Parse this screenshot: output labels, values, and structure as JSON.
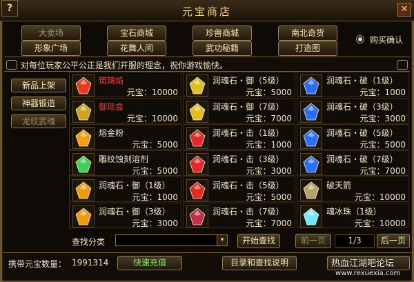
{
  "window": {
    "title": "元宝商店",
    "help_label": "?",
    "close_label": "✕"
  },
  "nav": {
    "row1": [
      "大卖场",
      "宝石商城",
      "珍兽商城",
      "南北奇货"
    ],
    "row2": [
      "形象广场",
      "花舞人间",
      "武功秘籍",
      "打造图"
    ]
  },
  "purchase_confirm": {
    "label": "购买确认",
    "checked": true
  },
  "notice": "对每位玩家公平公正是我们开服的理念，祝你游戏愉快。",
  "sidebar": [
    "新品上架",
    "神器锻造",
    "龙纹武魂"
  ],
  "items": [
    {
      "name": "琉璃焰",
      "price": "元宝：10000",
      "red": true,
      "icon": "flame-fan-icon",
      "color": "#e83a1a"
    },
    {
      "name": "润魂石・御（5级）",
      "price": "元宝：5000",
      "red": false,
      "icon": "yellow-gem-icon",
      "color": "#e0c020"
    },
    {
      "name": "润魂石・破（1级）",
      "price": "元宝：1000",
      "red": false,
      "icon": "blue-gem-icon",
      "color": "#2b6dff"
    },
    {
      "name": "御瑶盒",
      "price": "元宝：10000",
      "red": true,
      "icon": "gold-box-icon",
      "color": "#d0a020"
    },
    {
      "name": "润魂石・御（7级）",
      "price": "元宝：7000",
      "red": false,
      "icon": "yellow-gem-icon",
      "color": "#e0c020"
    },
    {
      "name": "润魂石・破（3级）",
      "price": "元宝：3000",
      "red": false,
      "icon": "blue-gem-icon",
      "color": "#2b6dff"
    },
    {
      "name": "熔金粉",
      "price": "元宝：5000",
      "red": false,
      "icon": "gold-powder-icon",
      "color": "#f0a010"
    },
    {
      "name": "润魂石・击（1级）",
      "price": "元宝：1000",
      "red": false,
      "icon": "red-gem-icon",
      "color": "#e32a2a"
    },
    {
      "name": "润魂石・破（5级）",
      "price": "元宝：5000",
      "red": false,
      "icon": "blue-gem-icon",
      "color": "#2b6dff"
    },
    {
      "name": "雕纹蚀刻溶剂",
      "price": "元宝：5000",
      "red": false,
      "icon": "green-solvent-icon",
      "color": "#3fd05a"
    },
    {
      "name": "润魂石・击（3级）",
      "price": "元宝：3000",
      "red": false,
      "icon": "red-gem-icon",
      "color": "#e32a2a"
    },
    {
      "name": "润魂石・破（7级）",
      "price": "元宝：7000",
      "red": false,
      "icon": "blue-gem-icon",
      "color": "#2b6dff"
    },
    {
      "name": "润魂石・御（1级）",
      "price": "元宝：1000",
      "red": false,
      "icon": "orange-gem-icon",
      "color": "#f09a10"
    },
    {
      "name": "润魂石・击（5级）",
      "price": "元宝：5000",
      "red": false,
      "icon": "red-gem-icon",
      "color": "#e32a2a"
    },
    {
      "name": "破天箭",
      "price": "元宝：10000",
      "red": false,
      "icon": "arrow-icon",
      "color": "#b8a070"
    },
    {
      "name": "润魂石・御（3级）",
      "price": "元宝：3000",
      "red": false,
      "icon": "orange-gem-icon",
      "color": "#f09a10"
    },
    {
      "name": "润魂石・击（7级）",
      "price": "元宝：7000",
      "red": false,
      "icon": "red-blue-gem-icon",
      "color": "#c0304a"
    },
    {
      "name": "魂冰珠（1级）",
      "price": "元宝：10000",
      "red": false,
      "icon": "ice-orb-icon",
      "color": "#6fe8ff"
    }
  ],
  "search": {
    "label": "查找分类",
    "dropdown_label": "▾",
    "start_label": "开始查找"
  },
  "paging": {
    "prev_label": "前一页",
    "page": "1/3",
    "next_label": "后一页"
  },
  "footer": {
    "ingot_label": "携带元宝数量：",
    "ingot_value": "1991314",
    "recharge_label": "快速充值",
    "catalog_label": "目录和查找说明",
    "watermark_cn": "热血江湖吧论坛",
    "watermark_url": "www.rexuexia.com"
  }
}
